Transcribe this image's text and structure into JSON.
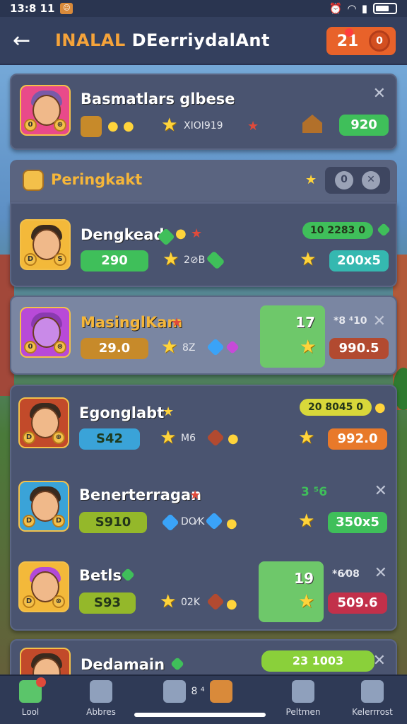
{
  "status_bar": {
    "time": "13:8 11",
    "app_icon": "app-badge-icon",
    "icons": [
      "alarm-icon",
      "wifi-icon",
      "signal-icon",
      "battery-icon"
    ]
  },
  "header": {
    "title_accent": "INALAL",
    "title_rest": "DEerriydalAnt",
    "badge_value": "21",
    "back_icon": "arrow-left-icon"
  },
  "cards": [
    {
      "title": "Basmatlars glbese",
      "sub_text": "XIOI919",
      "pill_value": "920",
      "pill_color": "green"
    }
  ],
  "section": {
    "title": "Peringkakt"
  },
  "rows": [
    {
      "title": "Dengkead",
      "stat_pill": "290",
      "mini_text": "2⊘B",
      "badge_text": "10 2283 0",
      "value_pill": "200x5"
    },
    {
      "title": "MasinglKam",
      "stat_pill": "29.0",
      "mini_text": "8Z",
      "block_value": "17",
      "side_text": "*8 ⁴10",
      "value_pill": "990.5"
    },
    {
      "title": "Egonglabt",
      "stat_pill": "S42",
      "mini_text": "M6",
      "badge_text": "20 8045 0",
      "value_pill": "992.0"
    },
    {
      "title": "Benerterragan",
      "stat_pill": "S910",
      "mini_text": "DO⁄K",
      "side_text": "3 ⁵6",
      "value_pill": "350x5"
    },
    {
      "title": "Betls",
      "stat_pill": "S93",
      "mini_text": "02K",
      "block_value": "19",
      "side_text": "*6⁄08",
      "value_pill": "509.6"
    },
    {
      "title": "Dedamain",
      "badge_text": "23 1003"
    }
  ],
  "bottom_nav": [
    {
      "label": "Lool",
      "icon": "home-icon"
    },
    {
      "label": "Abbres",
      "icon": "castle-icon"
    },
    {
      "label": "",
      "icon": "shop-icon",
      "extra": "8 ⁴"
    },
    {
      "label": "Peltmen",
      "icon": "pet-icon"
    },
    {
      "label": "Kelerrrost",
      "icon": "grid-icon"
    }
  ]
}
